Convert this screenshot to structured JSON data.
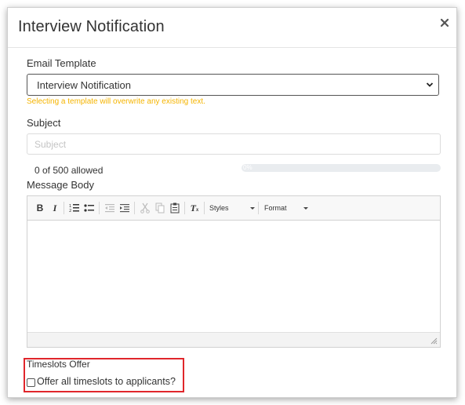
{
  "modal": {
    "title": "Interview Notification",
    "close_icon": "close-icon"
  },
  "email_template": {
    "label": "Email Template",
    "selected": "Interview Notification",
    "hint": "Selecting a template will overwrite any existing text."
  },
  "subject": {
    "label": "Subject",
    "placeholder": "Subject",
    "value": "",
    "count_text": "0 of 500 allowed",
    "progress_percent": 0,
    "progress_text": "0%"
  },
  "message_body": {
    "label": "Message Body",
    "toolbar": {
      "buttons": [
        {
          "name": "bold-icon",
          "glyph": "B"
        },
        {
          "name": "italic-icon",
          "glyph": "I"
        },
        {
          "name": "numbered-list-icon",
          "glyph": "≡"
        },
        {
          "name": "bulleted-list-icon",
          "glyph": "≡"
        },
        {
          "name": "outdent-icon",
          "glyph": "⇤"
        },
        {
          "name": "indent-icon",
          "glyph": "⇥"
        },
        {
          "name": "cut-icon",
          "glyph": "✂"
        },
        {
          "name": "copy-icon",
          "glyph": "⧉"
        },
        {
          "name": "paste-icon",
          "glyph": "📋"
        },
        {
          "name": "remove-format-icon",
          "glyph": "Tx"
        }
      ],
      "styles_label": "Styles",
      "format_label": "Format"
    },
    "content": ""
  },
  "timeslots": {
    "label": "Timeslots Offer",
    "checkbox_label": "Offer all timeslots to applicants?",
    "checked": false
  },
  "colors": {
    "hint": "#f5b400",
    "highlight_border": "#e0262b"
  }
}
